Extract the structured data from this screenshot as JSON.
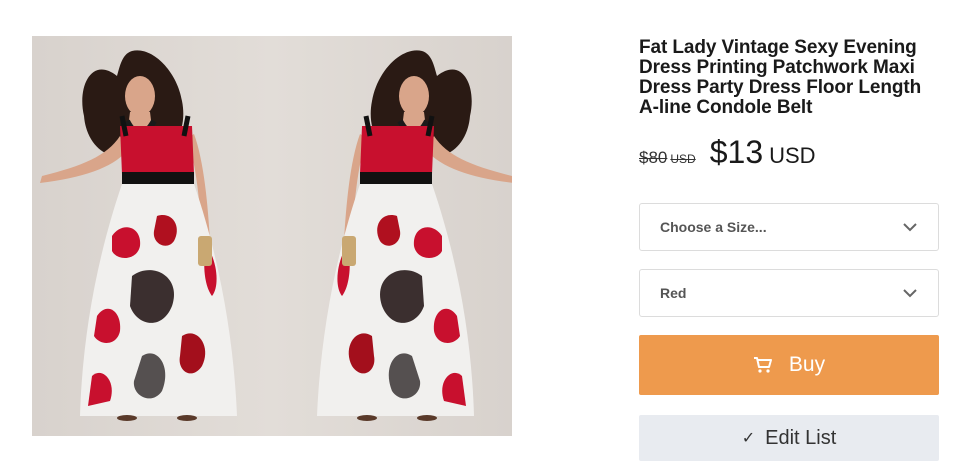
{
  "product": {
    "title": "Fat Lady Vintage Sexy Evening Dress Printing Patchwork Maxi Dress Party Dress Floor Length A-line Condole Belt",
    "old_price": "$80",
    "old_currency": "USD",
    "new_price": "$13",
    "new_currency": "USD"
  },
  "options": {
    "size": {
      "selected": "Choose a Size..."
    },
    "color": {
      "selected": "Red"
    }
  },
  "actions": {
    "buy_label": "Buy",
    "edit_label": "Edit List"
  },
  "icons": {
    "cart": "cart-icon",
    "check": "check-icon",
    "chevron": "chevron-down-icon"
  },
  "colors": {
    "buy_button": "#ee9a4d",
    "edit_button": "#e8ebf0",
    "dress_red": "#c8102e"
  }
}
